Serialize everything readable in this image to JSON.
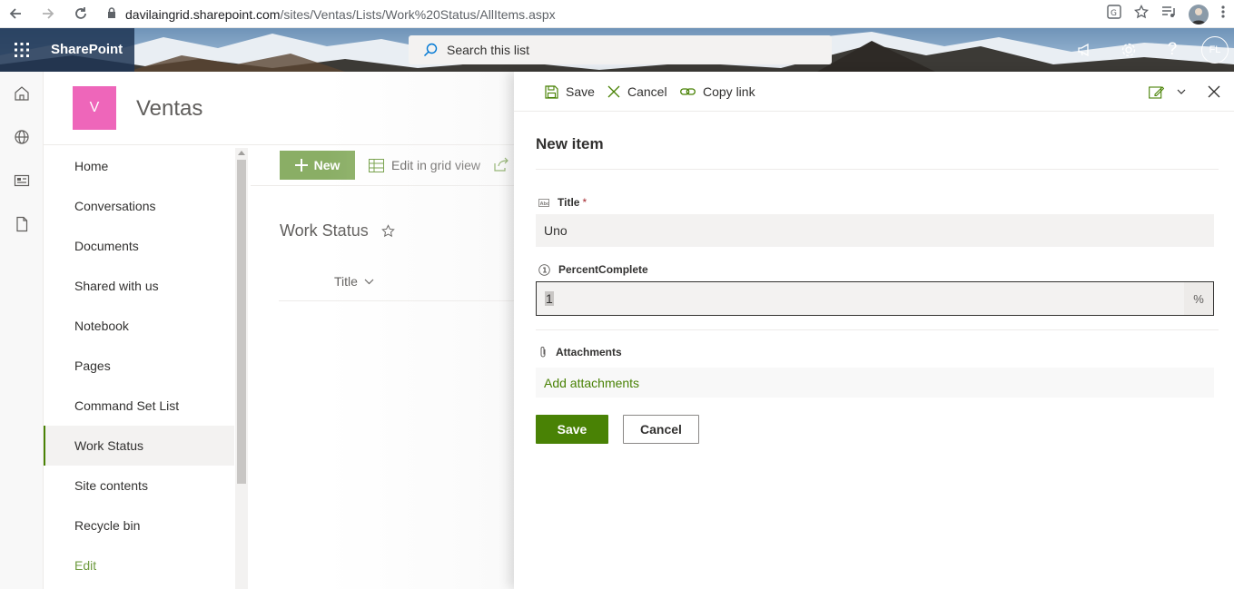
{
  "browser": {
    "url_host": "davilaingrid.sharepoint.com",
    "url_path": "/sites/Ventas/Lists/Work%20Status/AllItems.aspx"
  },
  "suite": {
    "brand": "SharePoint",
    "search_placeholder": "Search this list",
    "avatar_initials": "FL"
  },
  "site": {
    "logo_letter": "V",
    "title": "Ventas"
  },
  "leftnav": {
    "items": [
      {
        "label": "Home"
      },
      {
        "label": "Conversations"
      },
      {
        "label": "Documents"
      },
      {
        "label": "Shared with us"
      },
      {
        "label": "Notebook"
      },
      {
        "label": "Pages"
      },
      {
        "label": "Command Set List"
      },
      {
        "label": "Work Status",
        "active": true
      },
      {
        "label": "Site contents"
      },
      {
        "label": "Recycle bin"
      },
      {
        "label": "Edit"
      }
    ]
  },
  "commandbar": {
    "new_label": "New",
    "grid_label": "Edit in grid view"
  },
  "list": {
    "title": "Work Status",
    "column_title": "Title"
  },
  "panel": {
    "save_cmd": "Save",
    "cancel_cmd": "Cancel",
    "copy_link_cmd": "Copy link",
    "heading": "New item",
    "title_label": "Title",
    "title_required": "*",
    "title_value": "Uno",
    "percent_label": "PercentComplete",
    "percent_value": "1",
    "percent_suffix": "%",
    "attachments_label": "Attachments",
    "add_attachments": "Add attachments",
    "save_button": "Save",
    "cancel_button": "Cancel"
  },
  "colors": {
    "accent_green": "#498205",
    "suite_bar": "#2d4a6a",
    "site_logo": "#e3008c"
  }
}
